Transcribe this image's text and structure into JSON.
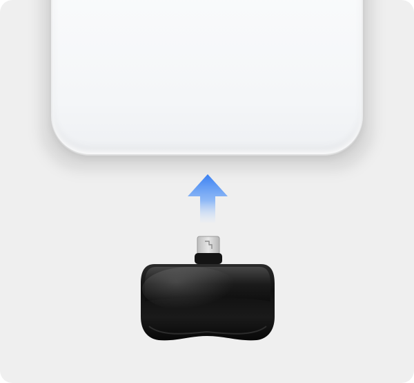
{
  "scene": {
    "background_color": "#efefef",
    "phone_color": "#f5f7f9",
    "arrow_color": "#3f86f5",
    "dongle_color": "#151515",
    "connector_color": "#cfcfcf"
  },
  "icons": {
    "direction": "arrow-up-icon",
    "device": "usb-dongle-icon",
    "port": "micro-usb-connector-icon"
  }
}
